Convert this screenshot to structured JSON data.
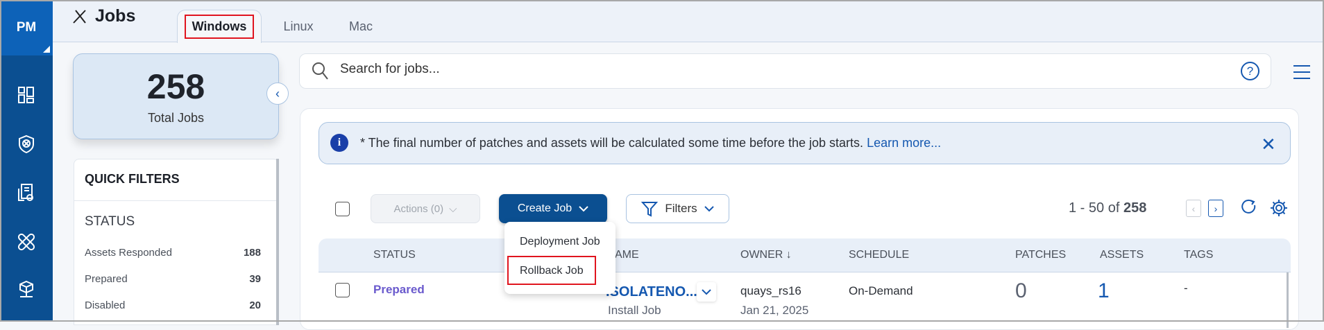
{
  "nav": {
    "brand": "PM",
    "items": [
      {
        "icon": "dashboard-icon"
      },
      {
        "icon": "shield-icon"
      },
      {
        "icon": "report-icon"
      },
      {
        "icon": "patch-icon"
      },
      {
        "icon": "network-icon"
      }
    ]
  },
  "header": {
    "title": "Jobs",
    "tabs": [
      {
        "label": "Windows",
        "selected": true
      },
      {
        "label": "Linux"
      },
      {
        "label": "Mac"
      }
    ]
  },
  "summary": {
    "total": "258",
    "label": "Total Jobs"
  },
  "quick_filters": {
    "title": "QUICK FILTERS",
    "section": "STATUS",
    "items": [
      {
        "label": "Assets Responded",
        "count": "188"
      },
      {
        "label": "Prepared",
        "count": "39"
      },
      {
        "label": "Disabled",
        "count": "20"
      }
    ]
  },
  "search": {
    "placeholder": "Search for jobs..."
  },
  "banner": {
    "text": "* The final number of patches and assets will be calculated some time before the job starts.",
    "link": "Learn more..."
  },
  "toolbar": {
    "actions": "Actions (0)",
    "create": "Create Job",
    "filters": "Filters",
    "range": "1 - 50 of",
    "total": "258"
  },
  "create_menu": {
    "items": [
      "Deployment Job",
      "Rollback Job"
    ]
  },
  "table": {
    "columns": [
      "STATUS",
      "AME",
      "OWNER ↓",
      "SCHEDULE",
      "PATCHES",
      "ASSETS",
      "TAGS"
    ],
    "rows": [
      {
        "status": "Prepared",
        "name": "ISOLATENO...",
        "type": "Install Job",
        "owner": "quays_rs16",
        "date": "Jan 21, 2025",
        "schedule": "On-Demand",
        "patches": "0",
        "assets": "1",
        "tags": "-"
      }
    ]
  },
  "colors": {
    "nav": "#0b4f91",
    "accent": "#1558b0",
    "highlight": "#e0141e",
    "status_prepared": "#6a5acd"
  }
}
